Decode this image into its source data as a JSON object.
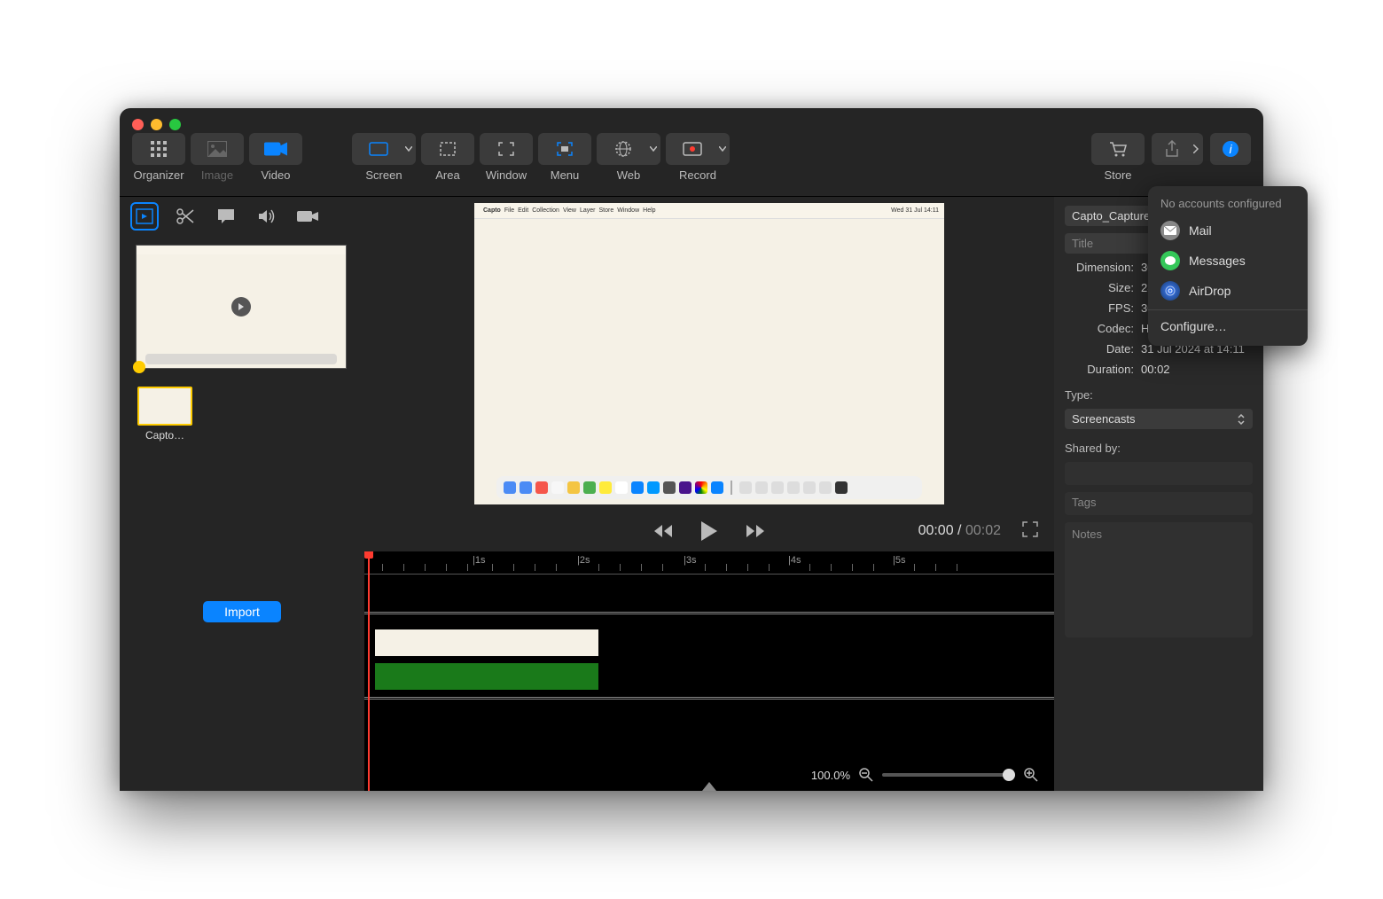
{
  "toolbar": {
    "organizer": "Organizer",
    "image": "Image",
    "video": "Video",
    "screen": "Screen",
    "area": "Area",
    "window": "Window",
    "menu": "Menu",
    "web": "Web",
    "record": "Record",
    "store": "Store"
  },
  "sidebar": {
    "thumb_label": "Capto…",
    "import": "Import"
  },
  "preview": {
    "menubar_items": [
      "Capto",
      "File",
      "Edit",
      "Collection",
      "View",
      "Layer",
      "Store",
      "Window",
      "Help"
    ],
    "menubar_date": "Wed 31 Jul 14:11"
  },
  "controls": {
    "current": "00:00",
    "duration": "00:02"
  },
  "timeline": {
    "seconds": [
      "1s",
      "2s",
      "3s",
      "4s",
      "5s"
    ],
    "zoom_pct": "100.0%"
  },
  "inspector": {
    "filename": "Capto_Capture",
    "title_placeholder": "Title",
    "dimension_label": "Dimension:",
    "dimension_val": "302",
    "size_label": "Size:",
    "size_val": "289",
    "fps_label": "FPS:",
    "fps_val": "30",
    "codec_label": "Codec:",
    "codec_val": "H.26",
    "date_label": "Date:",
    "date_val": "31 Jul 2024 at 14:11",
    "duration_label": "Duration:",
    "duration_val": "00:02",
    "type_label": "Type:",
    "type_val": "Screencasts",
    "shared_label": "Shared by:",
    "tags_placeholder": "Tags",
    "notes_placeholder": "Notes"
  },
  "popover": {
    "header": "No accounts configured",
    "mail": "Mail",
    "messages": "Messages",
    "airdrop": "AirDrop",
    "configure": "Configure…"
  }
}
